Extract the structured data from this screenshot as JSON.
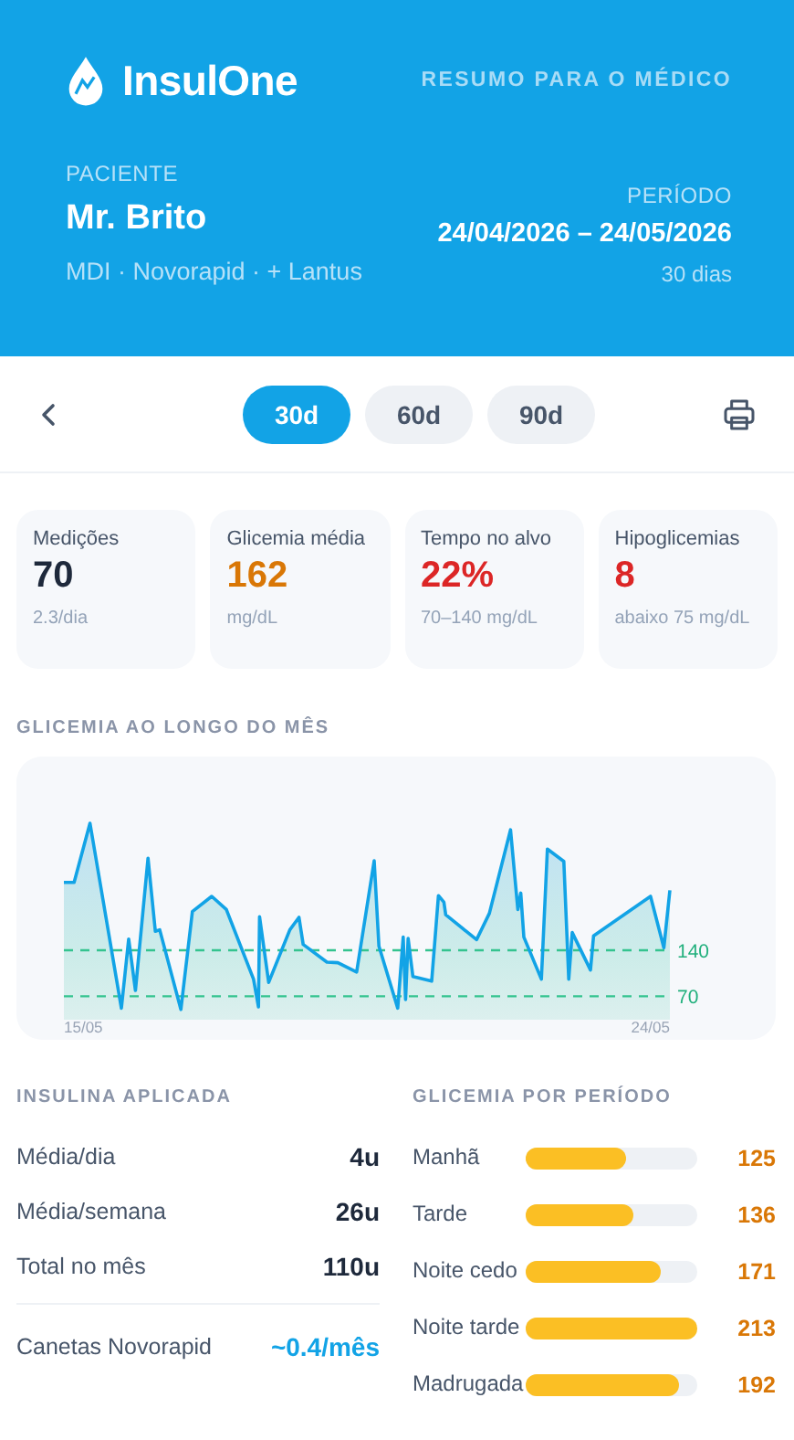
{
  "header": {
    "brand": "InsulOne",
    "subtitle": "RESUMO PARA O MÉDICO",
    "patient_label": "PACIENTE",
    "patient_name": "Mr. Brito",
    "therapy": "MDI · Novorapid · + Lantus",
    "period_label": "PERÍODO",
    "period_range": "24/04/2026 – 24/05/2026",
    "period_days": "30 dias"
  },
  "range_tabs": [
    {
      "label": "30d",
      "selected": true
    },
    {
      "label": "60d",
      "selected": false
    },
    {
      "label": "90d",
      "selected": false
    }
  ],
  "stats": [
    {
      "label": "Medições",
      "value": "70",
      "note": "2.3/dia",
      "color": "#1e293b"
    },
    {
      "label": "Glicemia média",
      "value": "162",
      "note": "mg/dL",
      "color": "#d97706"
    },
    {
      "label": "Tempo no alvo",
      "value": "22%",
      "note": "70–140 mg/dL",
      "color": "#dc2626"
    },
    {
      "label": "Hipoglicemias",
      "value": "8",
      "note": "abaixo 75 mg/dL",
      "color": "#dc2626"
    }
  ],
  "glucose_chart": {
    "title": "GLICEMIA AO LONGO DO MÊS",
    "date_labels": [
      "15/05",
      "24/05"
    ],
    "target_labels": [
      "140",
      "70"
    ]
  },
  "insulin": {
    "title": "INSULINA APLICADA",
    "rows": [
      {
        "label": "Média/dia",
        "value": "4u"
      },
      {
        "label": "Média/semana",
        "value": "26u"
      },
      {
        "label": "Total no mês",
        "value": "110u"
      }
    ],
    "pens": {
      "label": "Canetas Novorapid",
      "value": "~0.4/mês"
    }
  },
  "periods": {
    "title": "GLICEMIA POR PERÍODO",
    "rows": [
      {
        "label": "Manhã",
        "level": 0.58,
        "value": "125"
      },
      {
        "label": "Tarde",
        "level": 0.63,
        "value": "136"
      },
      {
        "label": "Noite cedo",
        "level": 0.79,
        "value": "171"
      },
      {
        "label": "Noite tarde",
        "level": 1.0,
        "value": "213"
      },
      {
        "label": "Madrugada",
        "level": 0.89,
        "value": "192"
      }
    ]
  }
}
